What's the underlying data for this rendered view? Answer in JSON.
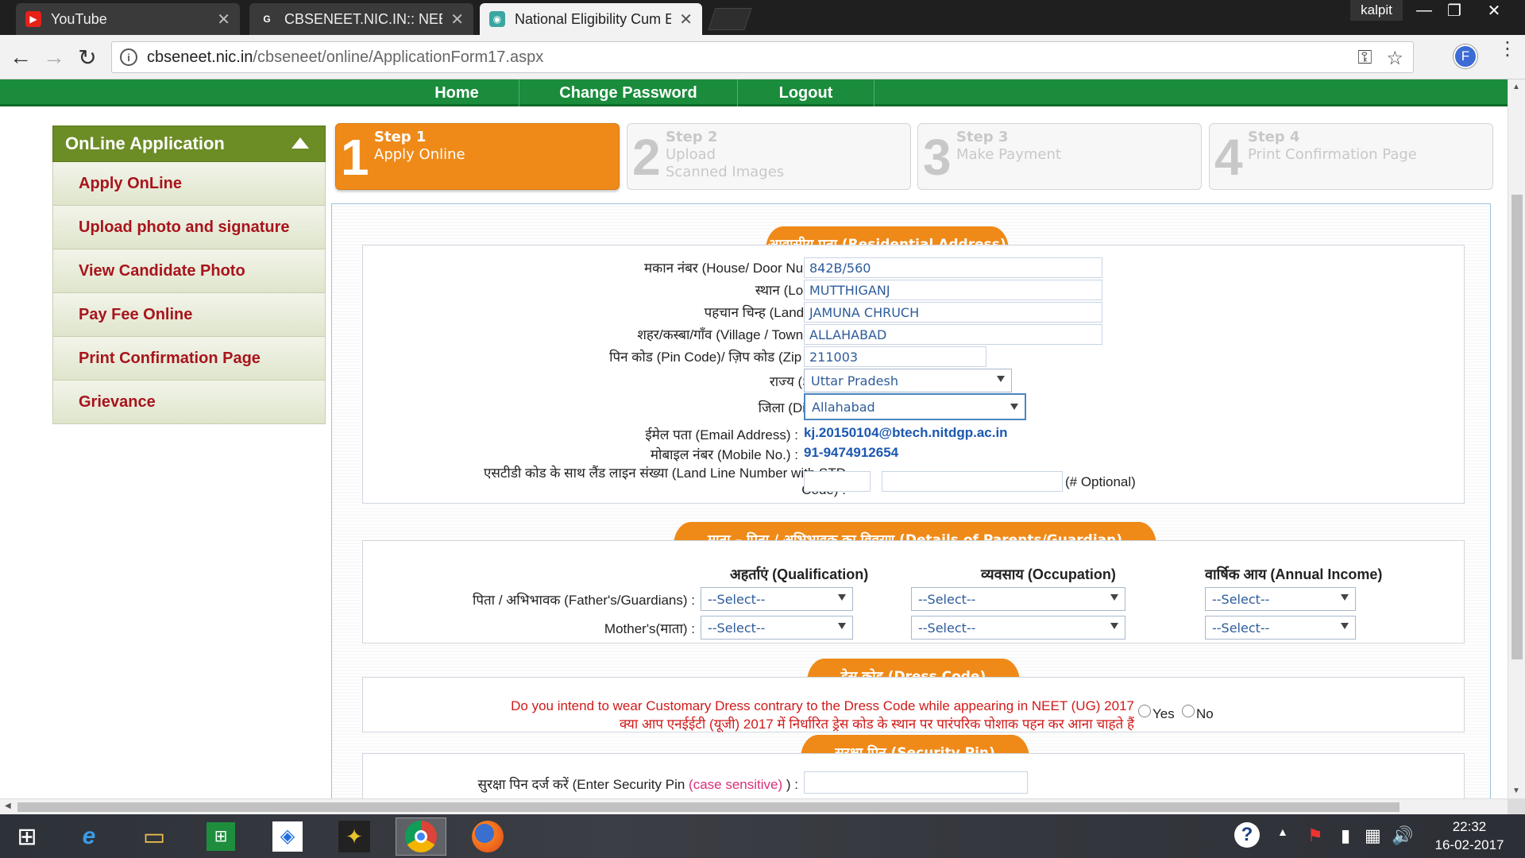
{
  "browser": {
    "tabs": [
      {
        "title": "YouTube",
        "favicon": "youtube-icon"
      },
      {
        "title": "CBSENEET.NIC.IN:: NEET",
        "favicon": "google-icon"
      },
      {
        "title": "National Eligibility Cum E",
        "favicon": "emblem-icon",
        "active": true
      }
    ],
    "profile_name": "kalpit",
    "url_host": "cbseneet.nic.in",
    "url_path": "/cbseneet/online/ApplicationForm17.aspx",
    "avatar_letter": "F"
  },
  "topnav": [
    "Home",
    "Change Password",
    "Logout"
  ],
  "sidebar": {
    "title": "OnLine Application",
    "items": [
      "Apply OnLine",
      "Upload photo and signature",
      "View Candidate Photo",
      "Pay Fee Online",
      "Print Confirmation Page",
      "Grievance"
    ]
  },
  "steps": [
    {
      "num": "1",
      "label": "Step 1",
      "text1": "Apply Online",
      "text2": "",
      "active": true
    },
    {
      "num": "2",
      "label": "Step 2",
      "text1": "Upload",
      "text2": "Scanned Images"
    },
    {
      "num": "3",
      "label": "Step 3",
      "text1": "Make Payment",
      "text2": ""
    },
    {
      "num": "4",
      "label": "Step 4",
      "text1": "Print Confirmation Page",
      "text2": ""
    }
  ],
  "address": {
    "title": "आवासीय पता (Residential Address)",
    "house_label": "मकान नंबर (House/ Door Number) :",
    "house_value": "842B/560",
    "locality_label": "स्थान (Locality) :",
    "locality_value": "MUTTHIGANJ",
    "landmark_label": "पहचान चिन्ह (Land Mark):",
    "landmark_value": "JAMUNA CHRUCH",
    "city_label": "शहर/कस्बा/गाँव (Village / Town / City):",
    "city_value": "ALLAHABAD",
    "pin_label": "पिन कोड (Pin Code)/ ज़िप कोड (Zip Code):",
    "pin_value": "211003",
    "state_label": "राज्य (State) :",
    "state_value": "Uttar Pradesh",
    "district_label": "जिला (District) :",
    "district_value": "Allahabad",
    "email_label": "ईमेल पता (Email Address) :",
    "email_value": "kj.20150104@btech.nitdgp.ac.in",
    "mobile_label": "मोबाइल नंबर (Mobile No.) :",
    "mobile_value": "91-9474912654",
    "landline_label1": "एसटीडी कोड के साथ लैंड लाइन संख्या (Land Line Number with STD",
    "landline_label2": "Code) :",
    "optional": "(# Optional)"
  },
  "parents": {
    "title": "माता – पिता / अभिभावक का विवरण (Details of Parents/Guardian)",
    "col_qualification": "अहर्ताएं (Qualification)",
    "col_occupation": "व्यवसाय (Occupation)",
    "col_income": "वार्षिक आय (Annual Income)",
    "father_label": "पिता / अभिभावक (Father's/Guardians) :",
    "mother_label": "Mother's(माता) :",
    "select_placeholder": "--Select--"
  },
  "dress": {
    "title": "ड्रेस कोड (Dress Code)",
    "question_en": "Do you intend to wear Customary Dress contrary to the Dress Code while appearing in NEET (UG) 2017",
    "question_hi": "क्या आप एनईईटी (यूजी) 2017 में निर्धारित ड्रेस कोड के स्थान पर पारंपरिक पोशाक पहन कर आना चाहते हैं",
    "yes": "Yes",
    "no": "No"
  },
  "security": {
    "title": "सुरक्षा पिन (Security Pin)",
    "label_pre": "सुरक्षा पिन दर्ज करें (Enter Security Pin",
    "label_case": "(case sensitive)",
    "label_post": ") :"
  },
  "taskbar": {
    "time": "22:32",
    "date": "16-02-2017"
  },
  "colors": {
    "nav_green": "#1a8c3c",
    "accent_orange": "#ef8a18",
    "sidebar_green": "#6c8c25",
    "link_red": "#a8141c"
  }
}
